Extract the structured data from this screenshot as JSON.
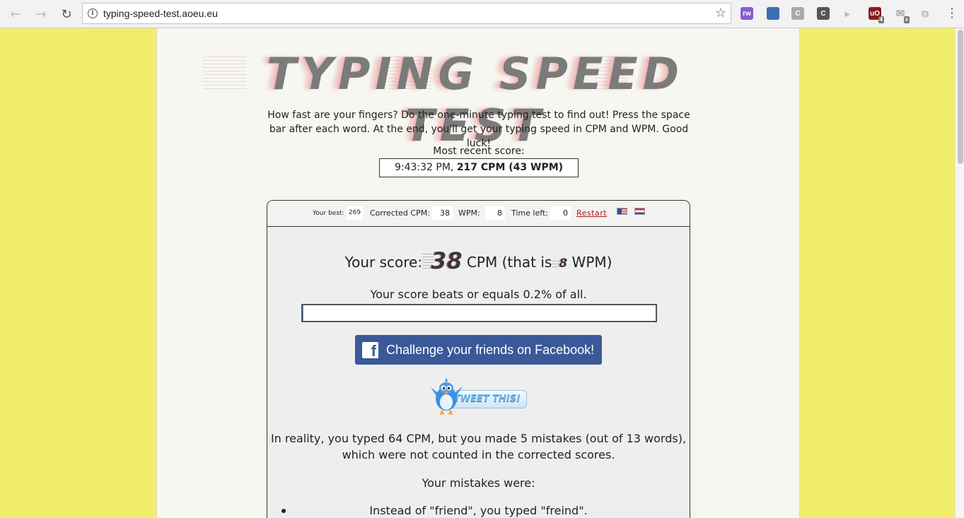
{
  "browser": {
    "url": "typing-speed-test.aoeu.eu",
    "extensions": [
      {
        "icon": "rw-extension-icon",
        "text": "rw",
        "color": "#8a5cd6"
      },
      {
        "icon": "window-extension-icon",
        "text": "",
        "color": "#3d6fb0"
      },
      {
        "icon": "c-extension-icon",
        "text": "C",
        "color": "#aaaaaa"
      },
      {
        "icon": "c-dark-extension-icon",
        "text": "C",
        "color": "#555555"
      },
      {
        "icon": "megaphone-extension-icon",
        "text": "",
        "color": "#bbbbbb"
      },
      {
        "icon": "ublock-extension-icon",
        "text": "uO",
        "color": "#8b1a1a",
        "badge": "4"
      },
      {
        "icon": "mail-extension-icon",
        "text": "",
        "color": "#bbbbbb",
        "badge": "x"
      },
      {
        "icon": "copy-extension-icon",
        "text": "",
        "color": "#bbbbbb"
      }
    ]
  },
  "page": {
    "logo_text": "TYPING SPEED TEST",
    "intro": "How fast are your fingers? Do the one-minute typing test to find out! Press the space bar after each word. At the end, you'll get your typing speed in CPM and WPM. Good luck!",
    "recent_label": "Most recent score:",
    "recent_time": "9:43:32 PM,",
    "recent_score": "217 CPM (43 WPM)"
  },
  "stats": {
    "best_label": "Your best:",
    "best_value": "269",
    "cpm_label": "Corrected CPM:",
    "cpm_value": "38",
    "wpm_label": "WPM:",
    "wpm_value": "8",
    "time_label": "Time left:",
    "time_value": "0",
    "restart_label": "Restart"
  },
  "result": {
    "score_prefix": "Your score:",
    "score_cpm": "38",
    "score_mid": "CPM (that is",
    "score_wpm": "8",
    "score_suffix": "WPM)",
    "beats_text": "Your score beats or equals 0.2% of all.",
    "beats_percent": 0.2,
    "facebook_label": "Challenge your friends on Facebook!",
    "tweet_label": "TWEET THIS!",
    "reality_text": "In reality, you typed 64 CPM, but you made 5 mistakes (out of 13 words), which were not counted in the corrected scores.",
    "mistakes_label": "Your mistakes were:",
    "mistakes": [
      "Instead of \"friend\", you typed \"freind\"."
    ]
  }
}
